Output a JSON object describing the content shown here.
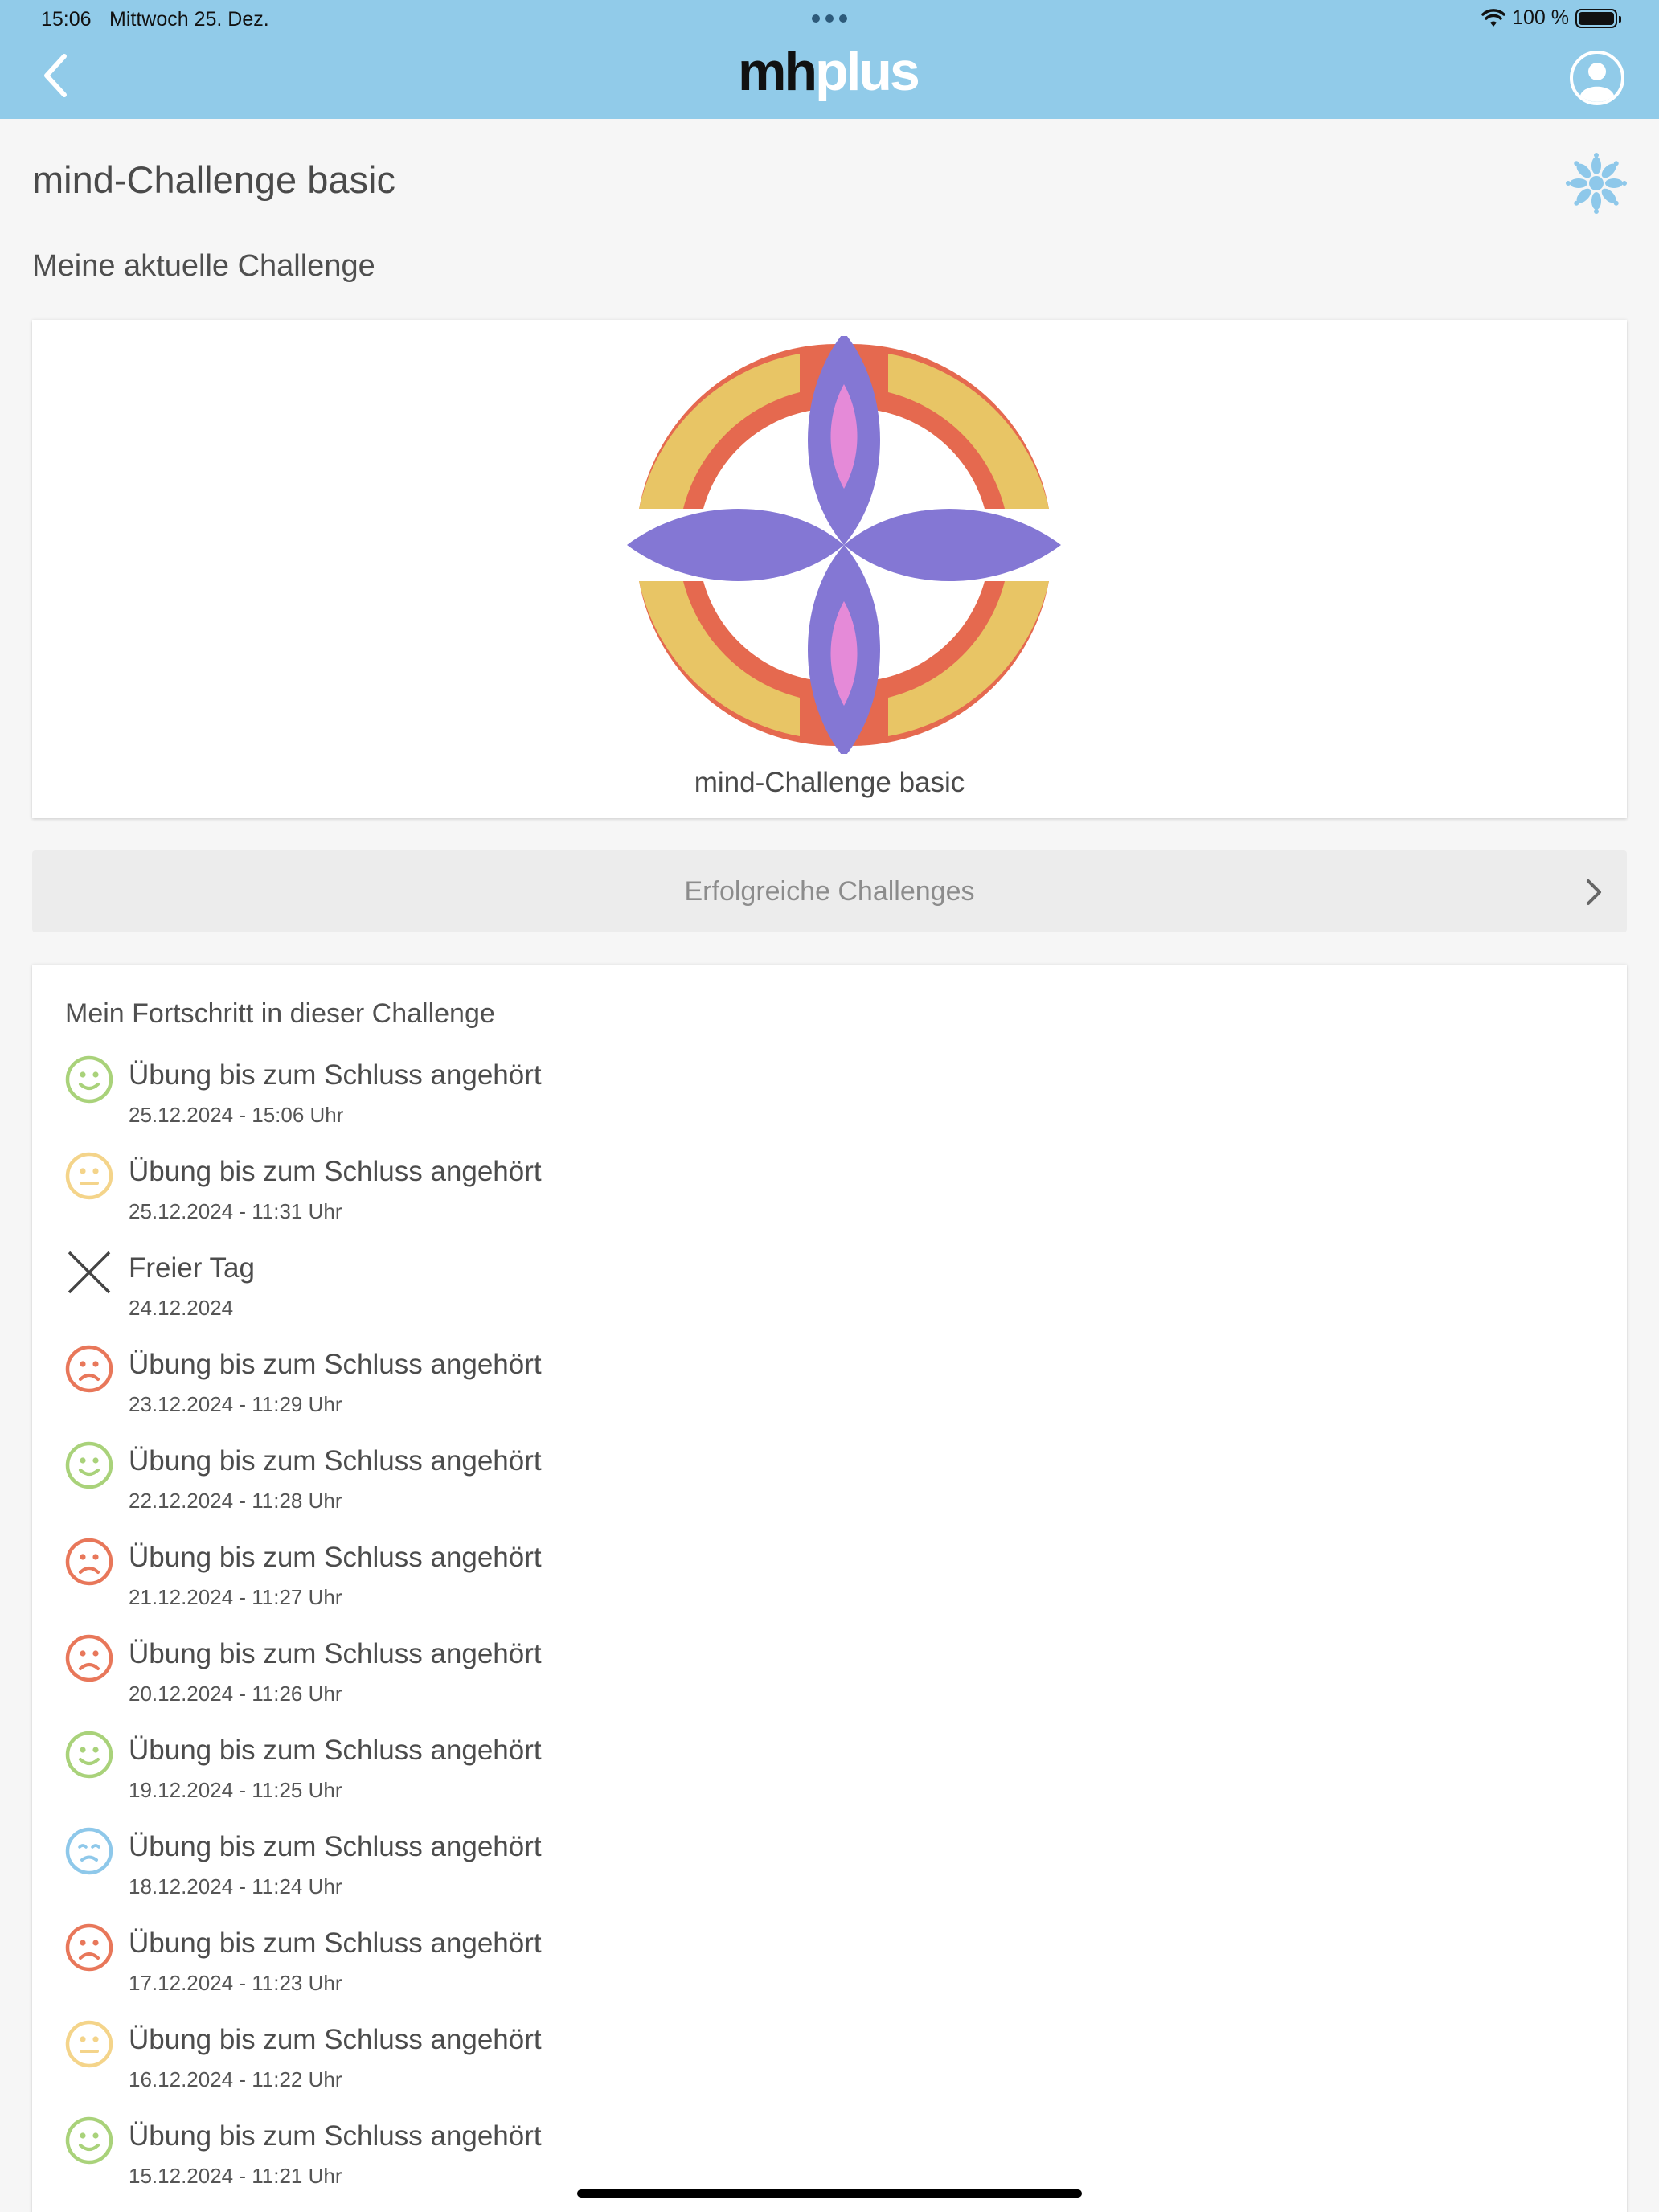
{
  "status_bar": {
    "time": "15:06",
    "date": "Mittwoch 25. Dez.",
    "battery": "100 %"
  },
  "nav": {
    "logo_mh": "mh",
    "logo_plus": "plus"
  },
  "page": {
    "title": "mind-Challenge basic",
    "section_title": "Meine aktuelle Challenge"
  },
  "challenge_card": {
    "name": "mind-Challenge basic"
  },
  "success_button": {
    "label": "Erfolgreiche Challenges"
  },
  "progress": {
    "title": "Mein Fortschritt in dieser Challenge",
    "entries": [
      {
        "icon": "happy-face-icon",
        "color": "#a9d27a",
        "title": "Übung bis zum Schluss angehört",
        "subtitle": "25.12.2024 - 15:06 Uhr"
      },
      {
        "icon": "neutral-face-icon",
        "color": "#f4d48a",
        "title": "Übung bis zum Schluss angehört",
        "subtitle": "25.12.2024 - 11:31 Uhr"
      },
      {
        "icon": "close-x-icon",
        "color": "#444444",
        "title": "Freier Tag",
        "subtitle": "24.12.2024"
      },
      {
        "icon": "sad-face-icon",
        "color": "#e8775a",
        "title": "Übung bis zum Schluss angehört",
        "subtitle": "23.12.2024 - 11:29 Uhr"
      },
      {
        "icon": "happy-face-icon",
        "color": "#a9d27a",
        "title": "Übung bis zum Schluss angehört",
        "subtitle": "22.12.2024 - 11:28 Uhr"
      },
      {
        "icon": "sad-face-icon",
        "color": "#e8775a",
        "title": "Übung bis zum Schluss angehört",
        "subtitle": "21.12.2024 - 11:27 Uhr"
      },
      {
        "icon": "sad-face-icon",
        "color": "#e8775a",
        "title": "Übung bis zum Schluss angehört",
        "subtitle": "20.12.2024 - 11:26 Uhr"
      },
      {
        "icon": "happy-face-icon",
        "color": "#a9d27a",
        "title": "Übung bis zum Schluss angehört",
        "subtitle": "19.12.2024 - 11:25 Uhr"
      },
      {
        "icon": "calm-face-icon",
        "color": "#8ec8ea",
        "title": "Übung bis zum Schluss angehört",
        "subtitle": "18.12.2024 - 11:24 Uhr"
      },
      {
        "icon": "sad-face-icon",
        "color": "#e8775a",
        "title": "Übung bis zum Schluss angehört",
        "subtitle": "17.12.2024 - 11:23 Uhr"
      },
      {
        "icon": "neutral-face-icon",
        "color": "#f4d48a",
        "title": "Übung bis zum Schluss angehört",
        "subtitle": "16.12.2024 - 11:22 Uhr"
      },
      {
        "icon": "happy-face-icon",
        "color": "#a9d27a",
        "title": "Übung bis zum Schluss angehört",
        "subtitle": "15.12.2024 - 11:21 Uhr"
      }
    ]
  }
}
